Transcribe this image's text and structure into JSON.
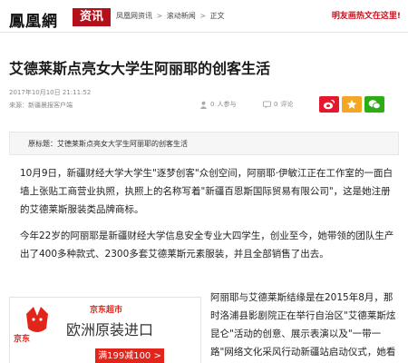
{
  "header": {
    "logo": "鳳凰網",
    "section": "资讯",
    "breadcrumb": [
      "凤凰网资讯",
      "滚动新闻",
      "正文"
    ],
    "breadcrumb_sep": ">",
    "promo": "明友画热文在这里!"
  },
  "article": {
    "title": "艾德莱斯点亮女大学生阿丽耶的创客生活",
    "date": "2017年10月10日 21:11:52",
    "source": "来源：新疆晨报客户端",
    "people_count": "人参与",
    "people_num": "0",
    "comments_count": "评论",
    "comments_num": "0",
    "summary": "原标题：艾德莱斯点亮女大学生阿丽耶的创客生活",
    "paragraphs": [
      "10月9日，新疆财经大学大学生\"逐梦创客\"众创空间，阿丽耶·伊敏江正在工作室的一面白墙上张贴工商营业执照，执照上的名称写着\"新疆百恩斯国际贸易有限公司\"，这是她注册的艾德莱斯服装类品牌商标。",
      "今年22岁的阿丽耶是新疆财经大学信息安全专业大四学生，创业至今，她带领的团队生产出了400多种款式、2300多套艾德莱斯元素服装，并且全部销售了出去。",
      "阿丽耶与艾德莱斯结缘是在2015年8月，那时洛浦县影剧院正在举行自治区\"艾德莱斯炫昆仑\"活动的创意、展示表演以及\"一带一路\"网络文化采风行动新疆站启动仪式，她看到舞台上华丽的"
    ]
  },
  "share": {
    "weibo_icon": "weibo-icon",
    "qzone_icon": "qzone-icon",
    "wechat_icon": "wechat-icon"
  },
  "ad": {
    "logo_text": "京东",
    "brand": "京东超市",
    "headline": "欧洲原装进口",
    "cta": "满199减100 >"
  },
  "colors": {
    "brand_red": "#b4101a",
    "weibo": "#e6162d",
    "qzone": "#f5a623",
    "wechat": "#2bad13",
    "jd_red": "#e1251b"
  }
}
